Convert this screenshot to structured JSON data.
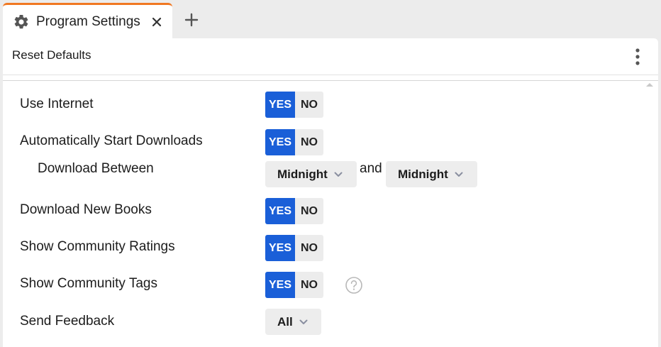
{
  "tabs": [
    {
      "label": "Program Settings",
      "icon": "gear-icon",
      "active": true
    }
  ],
  "toolbar": {
    "reset_label": "Reset Defaults"
  },
  "settings": {
    "use_internet": {
      "label": "Use Internet",
      "yes": "YES",
      "no": "NO",
      "value": "YES"
    },
    "auto_start_downloads": {
      "label": "Automatically Start Downloads",
      "yes": "YES",
      "no": "NO",
      "value": "YES"
    },
    "download_between": {
      "label": "Download Between",
      "start": "Midnight",
      "conjunction": "and",
      "end": "Midnight"
    },
    "download_new_books": {
      "label": "Download New Books",
      "yes": "YES",
      "no": "NO",
      "value": "YES"
    },
    "show_community_ratings": {
      "label": "Show Community Ratings",
      "yes": "YES",
      "no": "NO",
      "value": "YES"
    },
    "show_community_tags": {
      "label": "Show Community Tags",
      "yes": "YES",
      "no": "NO",
      "value": "YES"
    },
    "send_feedback": {
      "label": "Send Feedback",
      "value": "All"
    }
  },
  "colors": {
    "accent": "#1a5fd8",
    "tab_indicator": "#f07822",
    "background": "#ececec",
    "panel": "#ffffff"
  }
}
